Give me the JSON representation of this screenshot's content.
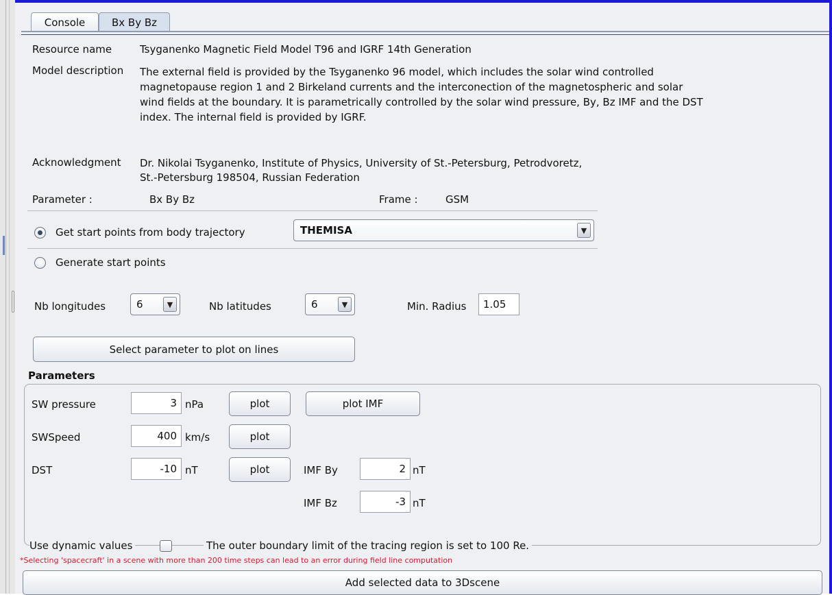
{
  "tabs": [
    {
      "label": "Console"
    },
    {
      "label": "Bx By Bz"
    }
  ],
  "resource": {
    "label": "Resource name",
    "value": "Tsyganenko Magnetic Field Model T96 and IGRF 14th Generation"
  },
  "model_description": {
    "label": "Model description",
    "lines": [
      "The external field is provided by the Tsyganenko 96 model, which includes the solar wind controlled",
      "magnetopause region 1 and 2 Birkeland currents and the interconection of the magnetospheric and solar",
      "wind fields at the boundary. It is parametrically controlled by the solar wind pressure, By, Bz IMF and the DST",
      "index. The internal field is provided by IGRF."
    ]
  },
  "acknowledgment": {
    "label": "Acknowledgment",
    "lines": [
      "Dr. Nikolai Tsyganenko, Institute of Physics, University of St.-Petersburg, Petrodvoretz,",
      "St.-Petersburg 198504, Russian Federation"
    ]
  },
  "parameter": {
    "label": "Parameter :",
    "value": "Bx By Bz"
  },
  "frame": {
    "label": "Frame :",
    "value": "GSM"
  },
  "start_points": {
    "option_trajectory": "Get start points from body trajectory",
    "option_generate": "Generate start points",
    "selected": "trajectory",
    "body": "THEMISA"
  },
  "grid": {
    "nb_longitudes_label": "Nb longitudes",
    "nb_longitudes": "6",
    "nb_latitudes_label": "Nb latitudes",
    "nb_latitudes": "6",
    "min_radius_label": "Min. Radius",
    "min_radius": "1.05"
  },
  "select_param_button": "Select parameter to plot on lines",
  "parameters": {
    "title": "Parameters",
    "sw_pressure": {
      "label": "SW pressure",
      "value": "3",
      "unit": "nPa",
      "plot": "plot"
    },
    "plot_imf": "plot IMF",
    "sw_speed": {
      "label": "SWSpeed",
      "value": "400",
      "unit": "km/s",
      "plot": "plot"
    },
    "dst": {
      "label": "DST",
      "value": "-10",
      "unit": "nT",
      "plot": "plot"
    },
    "imf_by": {
      "label": "IMF By",
      "value": "2",
      "unit": "nT"
    },
    "imf_bz": {
      "label": "IMF Bz",
      "value": "-3",
      "unit": "nT"
    },
    "use_dynamic": "Use dynamic values",
    "use_dynamic_checked": false,
    "boundary_note": "The outer boundary limit of the tracing region is set to 100 Re."
  },
  "warning": "*Selecting 'spacecraft' in a scene with more than 200 time steps can lead to an error during field line computation",
  "add_button": "Add selected data to 3Dscene",
  "colors": {
    "accent_border": "#1a1ad8",
    "warning": "#e8142a"
  }
}
